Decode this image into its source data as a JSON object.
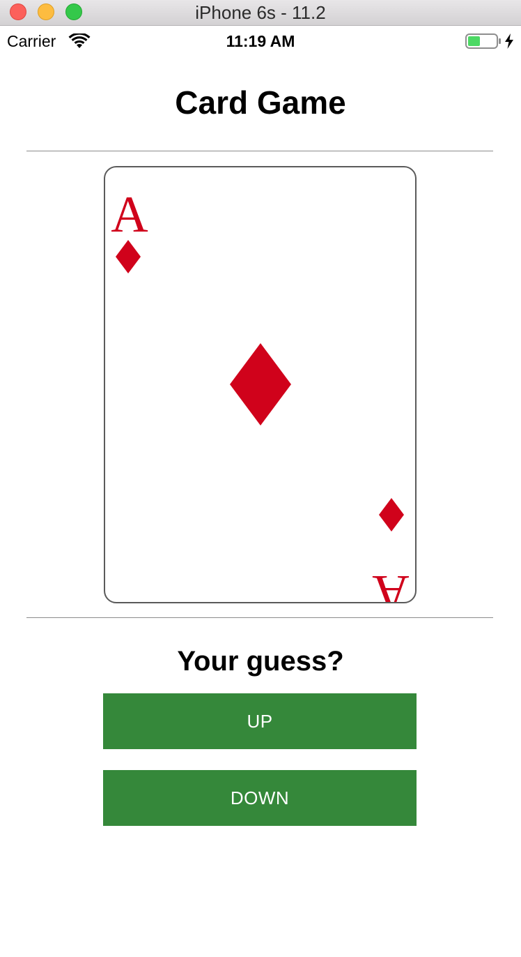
{
  "window": {
    "title": "iPhone 6s - 11.2"
  },
  "status_bar": {
    "carrier": "Carrier",
    "time": "11:19 AM",
    "wifi_icon": "wifi-icon",
    "battery_icon": "battery-icon",
    "charging_icon": "bolt-icon"
  },
  "app": {
    "title": "Card Game",
    "card": {
      "rank": "A",
      "suit": "diamonds",
      "suit_color": "#d0021b"
    },
    "guess_prompt": "Your guess?",
    "buttons": {
      "up_label": "UP",
      "down_label": "DOWN",
      "color": "#35883a"
    }
  }
}
